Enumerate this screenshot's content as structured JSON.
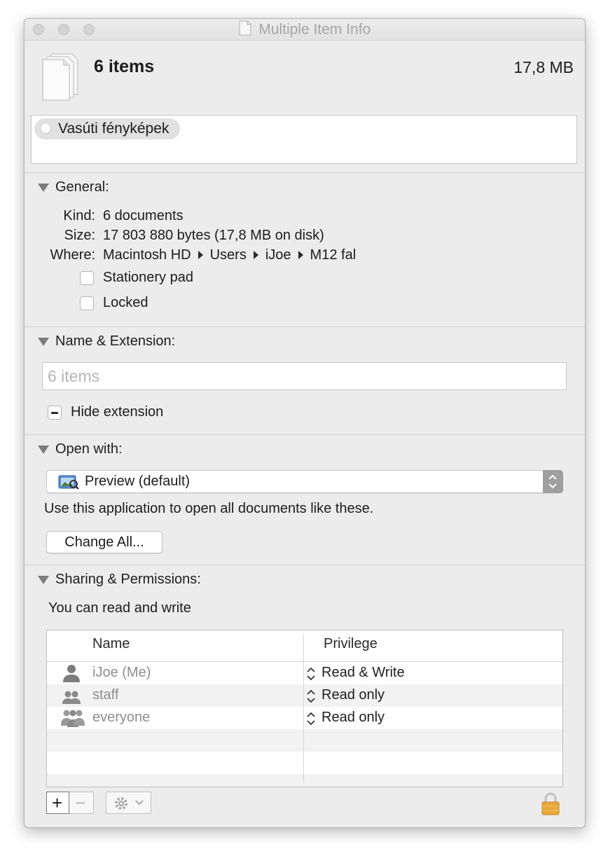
{
  "window": {
    "title": "Multiple Item Info"
  },
  "header": {
    "name": "6 items",
    "size": "17,8 MB"
  },
  "tags": {
    "items": [
      {
        "label": "Vasúti fényképek"
      }
    ]
  },
  "general": {
    "title": "General:",
    "kind_label": "Kind:",
    "kind_value": "6 documents",
    "size_label": "Size:",
    "size_value": "17 803 880 bytes (17,8 MB on disk)",
    "where_label": "Where:",
    "where_path": [
      "Macintosh HD",
      "Users",
      "iJoe",
      "M12 fal"
    ],
    "stationery_label": "Stationery pad",
    "stationery_checked": false,
    "locked_label": "Locked",
    "locked_checked": false
  },
  "name_ext": {
    "title": "Name & Extension:",
    "name_placeholder": "6 items",
    "hide_extension_label": "Hide extension",
    "hide_extension_state": "mixed"
  },
  "open_with": {
    "title": "Open with:",
    "selected": "Preview (default)",
    "description": "Use this application to open all documents like these.",
    "change_all": "Change All..."
  },
  "sharing": {
    "title": "Sharing & Permissions:",
    "status": "You can read and write",
    "columns": {
      "name": "Name",
      "privilege": "Privilege"
    },
    "rows": [
      {
        "name": "iJoe (Me)",
        "privilege": "Read & Write",
        "icon": "user-icon"
      },
      {
        "name": "staff",
        "privilege": "Read only",
        "icon": "group-icon"
      },
      {
        "name": "everyone",
        "privilege": "Read only",
        "icon": "everyone-icon"
      }
    ],
    "toolbar": {
      "add": "+",
      "remove": "−"
    }
  },
  "colors": {
    "window_bg": "#ececec",
    "lock": "#e8a838",
    "title_text": "#a6a6a6"
  }
}
